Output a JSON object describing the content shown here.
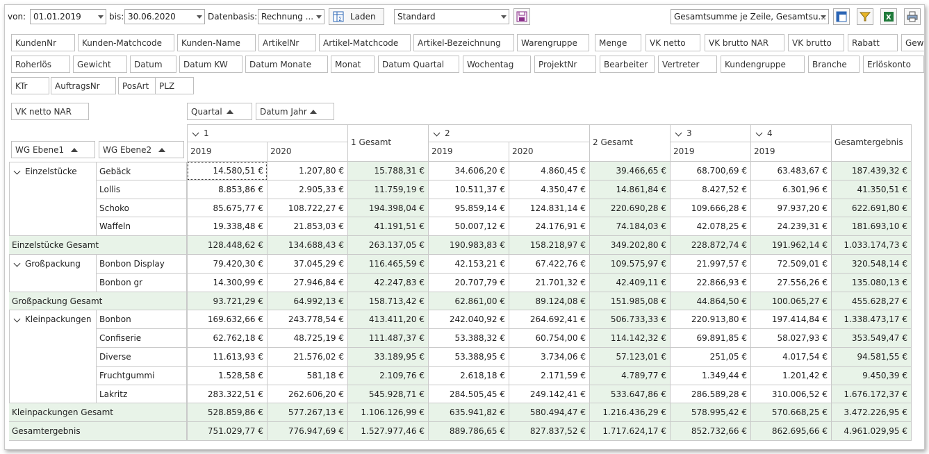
{
  "toolbar": {
    "von_label": "von:",
    "von_value": "01.01.2019",
    "bis_label": "bis:",
    "bis_value": "30.06.2020",
    "datenbasis_label": "Datenbasis:",
    "datenbasis_value": "Rechnung ...",
    "laden_label": "Laden",
    "layout_value": "Standard",
    "totals_value": "Gesamtsumme je Zeile, Gesamtsu..."
  },
  "field_row1": [
    "KundenNr",
    "Kunden-Matchcode",
    "Kunden-Name",
    "ArtikelNr",
    "Artikel-Matchcode",
    "Artikel-Bezeichnung",
    "Warengruppe",
    "Menge",
    "VK netto",
    "VK brutto NAR",
    "VK brutto",
    "Rabatt",
    "Gewin"
  ],
  "field_row2": [
    "Roherlös",
    "Gewicht",
    "Datum",
    "Datum KW",
    "Datum Monate",
    "Monat",
    "Datum Quartal",
    "Wochentag",
    "ProjektNr",
    "Bearbeiter",
    "Vertreter",
    "Kundengruppe",
    "Branche",
    "Erlöskonto"
  ],
  "field_row3": [
    "KTr",
    "AuftragsNr",
    "PosArt",
    "PLZ"
  ],
  "data_field": "VK netto NAR",
  "column_fields": [
    "Quartal",
    "Datum Jahr"
  ],
  "row_fields": [
    "WG Ebene1",
    "WG Ebene2"
  ],
  "column_header": {
    "quarters": [
      "1",
      "2",
      "3",
      "4"
    ],
    "years": [
      "2019",
      "2020",
      "2019",
      "2020",
      "2019",
      "2019"
    ],
    "q1_total": "1 Gesamt",
    "q2_total": "2 Gesamt",
    "grand_total": "Gesamtergebnis"
  },
  "groups": [
    {
      "name": "Einzelstücke",
      "rows": [
        {
          "name": "Gebäck",
          "values": [
            "14.580,51 €",
            "1.207,80 €",
            "15.788,31 €",
            "34.606,20 €",
            "4.860,45 €",
            "39.466,65 €",
            "68.700,69 €",
            "63.483,67 €",
            "187.439,32 €"
          ]
        },
        {
          "name": "Lollis",
          "values": [
            "8.853,86 €",
            "2.905,33 €",
            "11.759,19 €",
            "10.511,37 €",
            "4.350,47 €",
            "14.861,84 €",
            "8.427,52 €",
            "6.301,96 €",
            "41.350,51 €"
          ]
        },
        {
          "name": "Schoko",
          "values": [
            "85.675,77 €",
            "108.722,27 €",
            "194.398,04 €",
            "95.859,14 €",
            "124.831,14 €",
            "220.690,28 €",
            "109.666,28 €",
            "97.937,20 €",
            "622.691,80 €"
          ]
        },
        {
          "name": "Waffeln",
          "values": [
            "19.338,48 €",
            "21.853,03 €",
            "41.191,51 €",
            "50.007,12 €",
            "24.176,91 €",
            "74.184,03 €",
            "42.078,25 €",
            "24.239,31 €",
            "181.693,10 €"
          ]
        }
      ],
      "total_label": "Einzelstücke Gesamt",
      "total": [
        "128.448,62 €",
        "134.688,43 €",
        "263.137,05 €",
        "190.983,83 €",
        "158.218,97 €",
        "349.202,80 €",
        "228.872,74 €",
        "191.962,14 €",
        "1.033.174,73 €"
      ]
    },
    {
      "name": "Großpackung",
      "rows": [
        {
          "name": "Bonbon Display",
          "values": [
            "79.420,30 €",
            "37.045,29 €",
            "116.465,59 €",
            "42.153,21 €",
            "67.422,76 €",
            "109.575,97 €",
            "21.997,57 €",
            "72.509,01 €",
            "320.548,14 €"
          ]
        },
        {
          "name": "Bonbon gr",
          "values": [
            "14.300,99 €",
            "27.946,84 €",
            "42.247,83 €",
            "20.707,79 €",
            "21.701,32 €",
            "42.409,11 €",
            "22.866,93 €",
            "27.556,26 €",
            "135.080,13 €"
          ]
        }
      ],
      "total_label": "Großpackung Gesamt",
      "total": [
        "93.721,29 €",
        "64.992,13 €",
        "158.713,42 €",
        "62.861,00 €",
        "89.124,08 €",
        "151.985,08 €",
        "44.864,50 €",
        "100.065,27 €",
        "455.628,27 €"
      ]
    },
    {
      "name": "Kleinpackungen",
      "rows": [
        {
          "name": "Bonbon",
          "values": [
            "169.632,66 €",
            "243.778,54 €",
            "413.411,20 €",
            "242.040,92 €",
            "264.692,41 €",
            "506.733,33 €",
            "220.913,80 €",
            "197.414,84 €",
            "1.338.473,17 €"
          ]
        },
        {
          "name": "Confiserie",
          "values": [
            "62.762,18 €",
            "48.725,19 €",
            "111.487,37 €",
            "53.388,32 €",
            "60.754,00 €",
            "114.142,32 €",
            "69.891,85 €",
            "58.027,93 €",
            "353.549,47 €"
          ]
        },
        {
          "name": "Diverse",
          "values": [
            "11.613,93 €",
            "21.576,02 €",
            "33.189,95 €",
            "53.388,95 €",
            "3.734,06 €",
            "57.123,01 €",
            "251,05 €",
            "4.017,54 €",
            "94.581,55 €"
          ]
        },
        {
          "name": "Fruchtgummi",
          "values": [
            "1.528,58 €",
            "581,18 €",
            "2.109,76 €",
            "2.618,18 €",
            "2.171,59 €",
            "4.789,77 €",
            "1.349,44 €",
            "1.201,42 €",
            "9.450,39 €"
          ]
        },
        {
          "name": "Lakritz",
          "values": [
            "283.322,51 €",
            "262.606,20 €",
            "545.928,71 €",
            "284.505,45 €",
            "249.142,41 €",
            "533.647,86 €",
            "286.589,28 €",
            "310.006,52 €",
            "1.676.172,37 €"
          ]
        }
      ],
      "total_label": "Kleinpackungen Gesamt",
      "total": [
        "528.859,86 €",
        "577.267,13 €",
        "1.106.126,99 €",
        "635.941,82 €",
        "580.494,47 €",
        "1.216.436,29 €",
        "578.995,42 €",
        "570.668,25 €",
        "3.472.226,95 €"
      ]
    }
  ],
  "grand_total_label": "Gesamtergebnis",
  "grand_total": [
    "751.029,77 €",
    "776.947,69 €",
    "1.527.977,46 €",
    "889.786,65 €",
    "827.837,52 €",
    "1.717.624,17 €",
    "852.732,66 €",
    "862.695,66 €",
    "4.961.029,95 €"
  ]
}
